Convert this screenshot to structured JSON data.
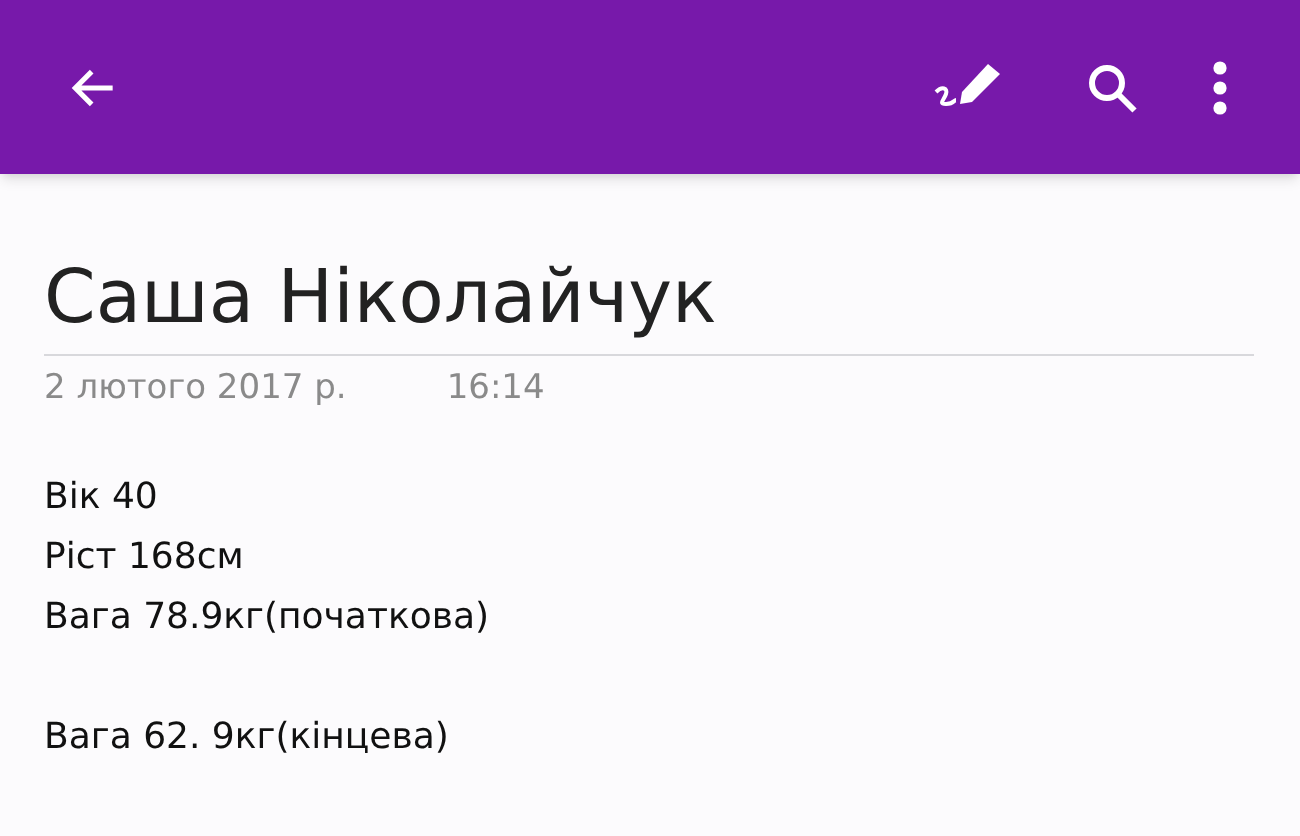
{
  "note": {
    "title": "Саша Ніколайчук",
    "date": "2 лютого 2017 р.",
    "time": "16:14",
    "paragraphs": [
      [
        "Вік 40",
        "Ріст 168см",
        "Вага 78.9кг(початкова)"
      ],
      [
        "Вага 62. 9кг(кінцева)"
      ]
    ]
  }
}
